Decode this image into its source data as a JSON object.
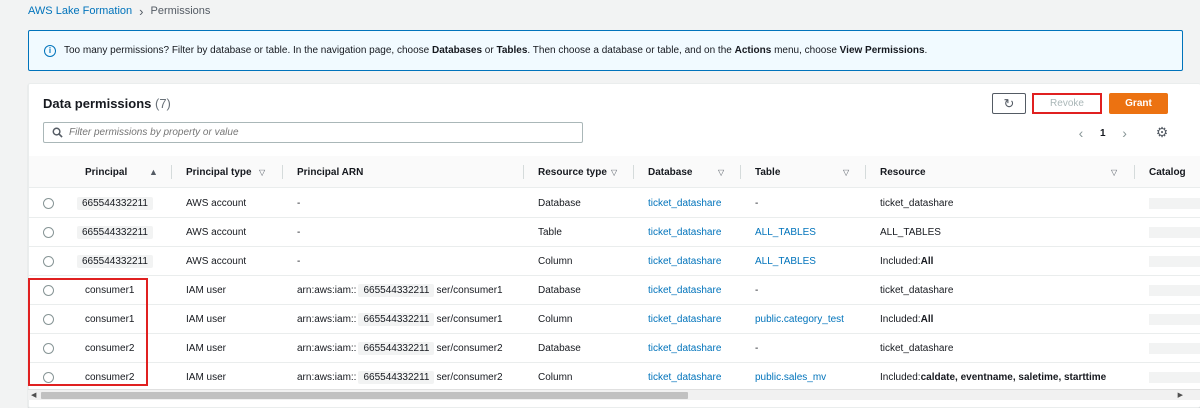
{
  "breadcrumb": {
    "root": "AWS Lake Formation",
    "current": "Permissions"
  },
  "info": {
    "pre": "Too many permissions? Filter by database or table. In the navigation page, choose ",
    "b1": "Databases",
    "mid1": " or ",
    "b2": "Tables",
    "mid2": ". Then choose a database or table, and on the ",
    "b3": "Actions",
    "mid3": " menu, choose ",
    "b4": "View Permissions",
    "post": "."
  },
  "panel": {
    "title": "Data permissions",
    "count": "(7)",
    "revoke_label": "Revoke",
    "grant_label": "Grant",
    "refresh_icon": "↻",
    "filter_placeholder": "Filter permissions by property or value",
    "page": "1"
  },
  "columns": {
    "principal": "Principal",
    "principal_type": "Principal type",
    "principal_arn": "Principal ARN",
    "resource_type": "Resource type",
    "database": "Database",
    "table": "Table",
    "resource": "Resource",
    "catalog": "Catalog"
  },
  "rows": [
    {
      "principal": "665544332211",
      "principal_type": "AWS account",
      "arn_pre": "-",
      "arn_id": "",
      "arn_post": "",
      "resource_type": "Database",
      "database": "ticket_datashare",
      "table": "-",
      "resource_label": "",
      "resource_value": "ticket_datashare"
    },
    {
      "principal": "665544332211",
      "principal_type": "AWS account",
      "arn_pre": "-",
      "arn_id": "",
      "arn_post": "",
      "resource_type": "Table",
      "database": "ticket_datashare",
      "table": "ALL_TABLES",
      "resource_label": "",
      "resource_value": "ALL_TABLES"
    },
    {
      "principal": "665544332211",
      "principal_type": "AWS account",
      "arn_pre": "-",
      "arn_id": "",
      "arn_post": "",
      "resource_type": "Column",
      "database": "ticket_datashare",
      "table": "ALL_TABLES",
      "resource_label": "Included: ",
      "resource_value": "All"
    },
    {
      "principal": "consumer1",
      "principal_type": "IAM user",
      "arn_pre": "arn:aws:iam::",
      "arn_id": "665544332211",
      "arn_post": "ser/consumer1",
      "resource_type": "Database",
      "database": "ticket_datashare",
      "table": "-",
      "resource_label": "",
      "resource_value": "ticket_datashare"
    },
    {
      "principal": "consumer1",
      "principal_type": "IAM user",
      "arn_pre": "arn:aws:iam::",
      "arn_id": "665544332211",
      "arn_post": "ser/consumer1",
      "resource_type": "Column",
      "database": "ticket_datashare",
      "table": "public.category_test",
      "resource_label": "Included: ",
      "resource_value": "All"
    },
    {
      "principal": "consumer2",
      "principal_type": "IAM user",
      "arn_pre": "arn:aws:iam::",
      "arn_id": "665544332211",
      "arn_post": "ser/consumer2",
      "resource_type": "Database",
      "database": "ticket_datashare",
      "table": "-",
      "resource_label": "",
      "resource_value": "ticket_datashare"
    },
    {
      "principal": "consumer2",
      "principal_type": "IAM user",
      "arn_pre": "arn:aws:iam::",
      "arn_id": "665544332211",
      "arn_post": "ser/consumer2",
      "resource_type": "Column",
      "database": "ticket_datashare",
      "table": "public.sales_mv",
      "resource_label": "Included: ",
      "resource_value": "caldate, eventname, saletime, starttime"
    }
  ]
}
